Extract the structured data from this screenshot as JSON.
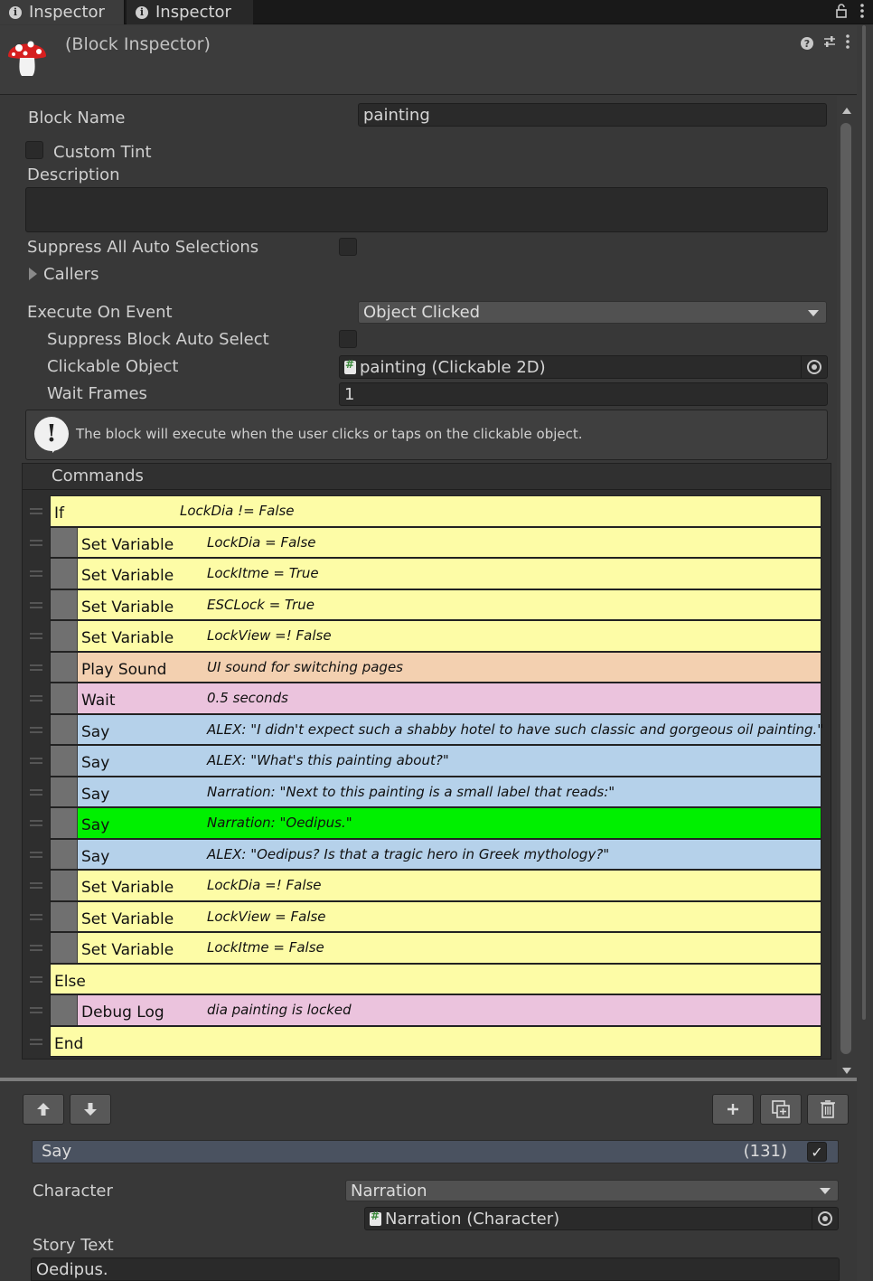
{
  "tabs": [
    {
      "label": "Inspector",
      "active": true
    },
    {
      "label": "Inspector",
      "active": false
    }
  ],
  "header": {
    "title": "(Block Inspector)",
    "icons": [
      "help-icon",
      "sliders-icon",
      "kebab-menu-icon"
    ]
  },
  "block": {
    "name_label": "Block Name",
    "name_value": "painting",
    "custom_tint_label": "Custom Tint",
    "custom_tint_checked": false,
    "description_label": "Description",
    "description_value": "",
    "suppress_all_label": "Suppress All Auto Selections",
    "suppress_all_checked": false,
    "callers_label": "Callers",
    "execute_label": "Execute On Event",
    "execute_value": "Object Clicked",
    "suppress_block_label": "Suppress Block Auto Select",
    "suppress_block_checked": false,
    "clickable_label": "Clickable Object",
    "clickable_value": "painting (Clickable 2D)",
    "wait_frames_label": "Wait Frames",
    "wait_frames_value": "1",
    "help_text": "The block will execute when the user clicks or taps on the clickable object."
  },
  "commands": {
    "header": "Commands",
    "items": [
      {
        "name": "If",
        "summary": "LockDia != False",
        "indent": 0,
        "color": "yellow"
      },
      {
        "name": "Set Variable",
        "summary": "LockDia = False",
        "indent": 1,
        "color": "yellow"
      },
      {
        "name": "Set Variable",
        "summary": "LockItme = True",
        "indent": 1,
        "color": "yellow"
      },
      {
        "name": "Set Variable",
        "summary": "ESCLock = True",
        "indent": 1,
        "color": "yellow"
      },
      {
        "name": "Set Variable",
        "summary": "LockView =! False",
        "indent": 1,
        "color": "yellow"
      },
      {
        "name": "Play Sound",
        "summary": "UI sound for switching pages",
        "indent": 1,
        "color": "peach"
      },
      {
        "name": "Wait",
        "summary": "0.5 seconds",
        "indent": 1,
        "color": "pink"
      },
      {
        "name": "Say",
        "summary": "ALEX: \"I didn't expect such a shabby hotel to have such classic and gorgeous oil painting.\"",
        "indent": 1,
        "color": "blue"
      },
      {
        "name": "Say",
        "summary": "ALEX: \"What's this painting about?\"",
        "indent": 1,
        "color": "blue"
      },
      {
        "name": "Say",
        "summary": "Narration: \"Next to this painting is a small label that reads:\"",
        "indent": 1,
        "color": "blue"
      },
      {
        "name": "Say",
        "summary": "Narration: \"Oedipus.\"",
        "indent": 1,
        "color": "green"
      },
      {
        "name": "Say",
        "summary": "ALEX: \"Oedipus? Is that a tragic hero in Greek mythology?\"",
        "indent": 1,
        "color": "blue"
      },
      {
        "name": "Set Variable",
        "summary": "LockDia =! False",
        "indent": 1,
        "color": "yellow"
      },
      {
        "name": "Set Variable",
        "summary": "LockView = False",
        "indent": 1,
        "color": "yellow"
      },
      {
        "name": "Set Variable",
        "summary": "LockItme = False",
        "indent": 1,
        "color": "yellow"
      },
      {
        "name": "Else",
        "summary": "",
        "indent": 0,
        "color": "yellow"
      },
      {
        "name": "Debug Log",
        "summary": "dia painting is locked",
        "indent": 1,
        "color": "pink"
      },
      {
        "name": "End",
        "summary": "",
        "indent": 0,
        "color": "yellow"
      }
    ]
  },
  "colors": {
    "yellow": "#fdfca6",
    "peach": "#f3d0b0",
    "pink": "#ebc3dd",
    "blue": "#b5d1ea",
    "green": "#00f000"
  },
  "toolbar": {
    "up_icon": "arrow-up-icon",
    "down_icon": "arrow-down-icon",
    "add_icon": "plus-icon",
    "duplicate_icon": "duplicate-icon",
    "delete_icon": "trash-icon"
  },
  "selected_command": {
    "name": "Say",
    "count": "(131)",
    "enabled": true,
    "character_label": "Character",
    "character_value": "Narration",
    "character_object": "Narration (Character)",
    "story_text_label": "Story Text",
    "story_text_value": "Oedipus."
  }
}
